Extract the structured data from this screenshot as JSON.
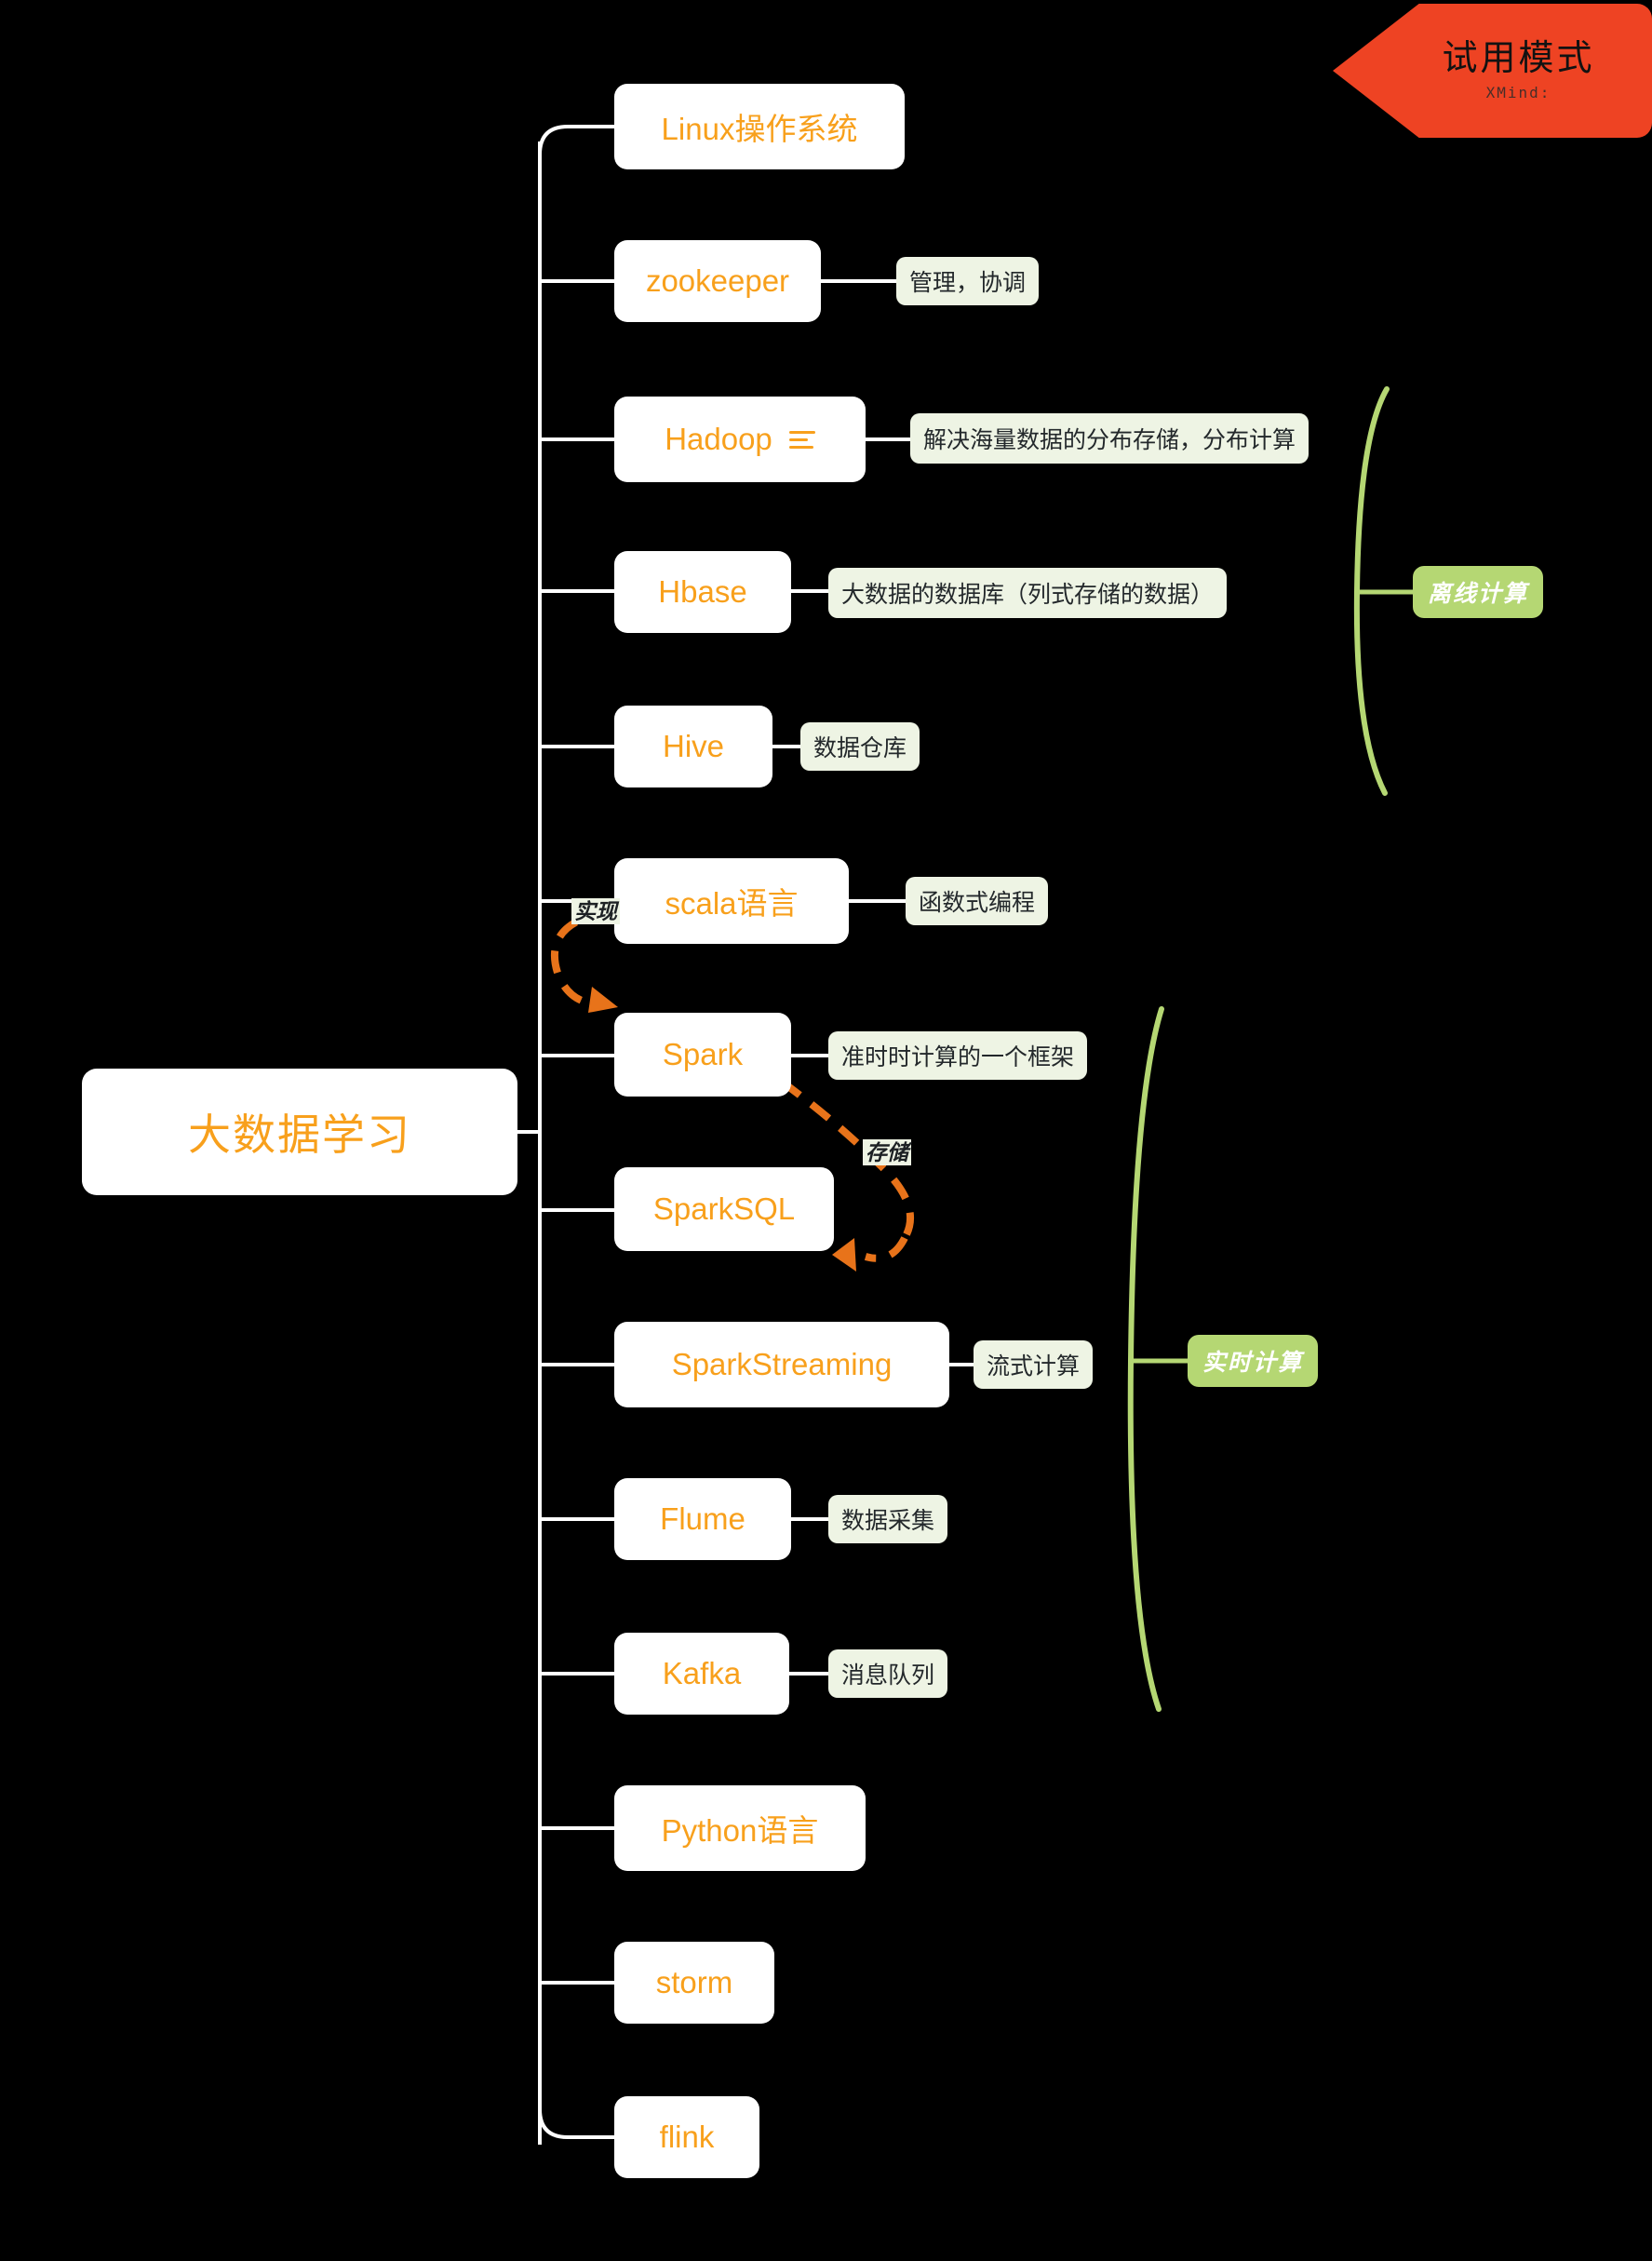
{
  "app": {
    "background_color": "#000000",
    "node_fill": "#ffffff",
    "node_text_color": "#f8a01c",
    "note_fill": "#eef4e4",
    "note_text_color": "#23282b",
    "summary_color": "#b5d773",
    "relationship_color": "#e8731a",
    "branch_line_color": "#ffffff"
  },
  "trial_banner": {
    "title": "试用模式",
    "subtitle": "XMind:",
    "background_color": "#ee4323"
  },
  "root": {
    "label": "大数据学习"
  },
  "topics": [
    {
      "label": "Linux操作系统",
      "note": ""
    },
    {
      "label": "zookeeper",
      "note": "管理，协调"
    },
    {
      "label": "Hadoop",
      "note": "解决海量数据的分布存储，分布计算",
      "icon": "notes-lines-icon"
    },
    {
      "label": "Hbase",
      "note": "大数据的数据库（列式存储的数据）"
    },
    {
      "label": "Hive",
      "note": "数据仓库"
    },
    {
      "label": "scala语言",
      "note": "函数式编程"
    },
    {
      "label": "Spark",
      "note": "准时时计算的一个框架"
    },
    {
      "label": "SparkSQL",
      "note": ""
    },
    {
      "label": "SparkStreaming",
      "note": "流式计算"
    },
    {
      "label": "Flume",
      "note": "数据采集"
    },
    {
      "label": "Kafka",
      "note": "消息队列"
    },
    {
      "label": "Python语言",
      "note": ""
    },
    {
      "label": "storm",
      "note": ""
    },
    {
      "label": "flink",
      "note": ""
    }
  ],
  "summaries": [
    {
      "label": "离线计算",
      "covers": "Hadoop - Hive"
    },
    {
      "label": "实时计算",
      "covers": "Spark - Kafka"
    }
  ],
  "relationships": [
    {
      "label": "实现",
      "from": "scala语言",
      "to": "Spark"
    },
    {
      "label": "存储",
      "from": "Spark",
      "to": "SparkSQL"
    }
  ]
}
